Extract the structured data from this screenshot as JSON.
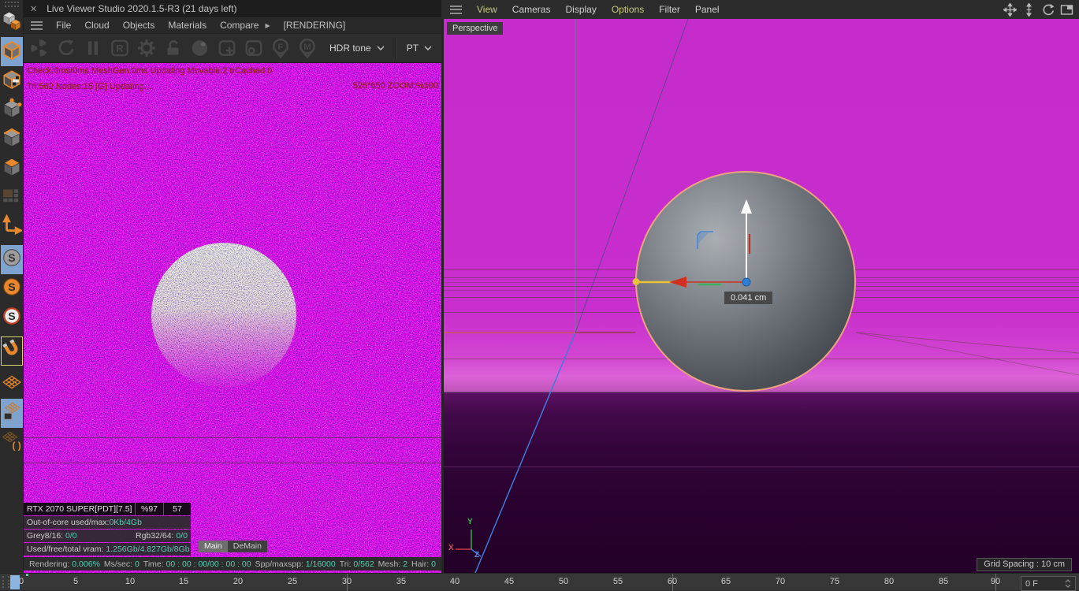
{
  "left_palette": {
    "items": [
      {
        "name": "make-editable"
      },
      {
        "name": "model-mode"
      },
      {
        "name": "texture-mode"
      },
      {
        "name": "points-mode"
      },
      {
        "name": "edges-mode"
      },
      {
        "name": "polygons-mode"
      },
      {
        "name": "uv-mode-disabled"
      },
      {
        "name": "enable-axis"
      },
      {
        "name": "snap-gray"
      },
      {
        "name": "snap-orange"
      },
      {
        "name": "snap-white"
      },
      {
        "name": "magnet-snap"
      },
      {
        "name": "workplane"
      },
      {
        "name": "lock-workplane"
      },
      {
        "name": "workplane-mode"
      }
    ]
  },
  "live_viewer": {
    "title": "Live Viewer Studio 2020.1.5-R3 (21 days left)",
    "close_glyph": "✕",
    "menu_items": [
      "File",
      "Cloud",
      "Objects",
      "Materials",
      "Compare",
      "[RENDERING]"
    ],
    "submenu_arrow_glyph": "▶",
    "toolbar_icons": [
      "octane-fan",
      "refresh",
      "pause",
      "restart-render",
      "settings-gear",
      "lock-resolution",
      "render-ball",
      "add-region",
      "pick-region",
      "focus-pick",
      "material-pick"
    ],
    "hdr_dropdown": "HDR tone",
    "mode_dropdown": "PT",
    "render": {
      "stats_line1": "Check:0ms/0ms MeshGen:0ms Updating Movable:2 trCached:0",
      "stats_line2": "Tri:562 Nodes:15  [G] Updating....",
      "zoom_info": "526*650 ZOOM:%100"
    },
    "gpu_panel": {
      "gpu": "RTX 2070 SUPER[PDT][7.5]",
      "load": "%97",
      "temp": "57",
      "rows": [
        {
          "label": "Out-of-core used/max:",
          "value": "0Kb/4Gb"
        },
        {
          "label": "Grey8/16:",
          "value": "0/0",
          "label2": "Rgb32/64:",
          "value2": "0/0"
        },
        {
          "label": "Used/free/total vram:",
          "value": "1.256Gb/4.827Gb/8Gb"
        }
      ]
    },
    "tabs": [
      {
        "label": "Main"
      },
      {
        "label": "DeMain"
      }
    ],
    "status_bar": [
      {
        "label": "Rendering:",
        "value": "0.006%"
      },
      {
        "label": "Ms/sec:",
        "value": "0"
      },
      {
        "label": "Time:",
        "value": "00 : 00 : 00/00 : 00 : 00"
      },
      {
        "label": "Spp/maxspp:",
        "value": "1/16000"
      },
      {
        "label": "Tri:",
        "value": "0/562"
      },
      {
        "label": "Mesh:",
        "value": "2"
      },
      {
        "label": "Hair:",
        "value": "0"
      }
    ]
  },
  "viewport": {
    "menu_items": [
      {
        "label": "View"
      },
      {
        "label": "Cameras"
      },
      {
        "label": "Display"
      },
      {
        "label": "Options"
      },
      {
        "label": "Filter"
      },
      {
        "label": "Panel"
      }
    ],
    "nav_icons": [
      "pan",
      "dolly",
      "rotate",
      "toggle-layout"
    ],
    "view_label": "Perspective",
    "move_tooltip": "0.041 cm",
    "grid_spacing": "Grid Spacing : 10 cm",
    "axis_labels": {
      "x": "X",
      "y": "Y",
      "z": "Z"
    }
  },
  "timeline": {
    "marks": [
      "0",
      "5",
      "10",
      "15",
      "20",
      "25",
      "30",
      "35",
      "40",
      "45",
      "50",
      "55",
      "60",
      "65",
      "70",
      "75",
      "80",
      "85",
      "90"
    ],
    "frame_value": "0 F"
  },
  "colors": {
    "render_magenta": "#ee10ee",
    "viewport_magenta": "#c52bca",
    "floor_purple": "#2e0334",
    "teal_value": "#52d0b4",
    "sphere_outline": "#eca37e",
    "highlight_blue": "#7fa3cf"
  }
}
